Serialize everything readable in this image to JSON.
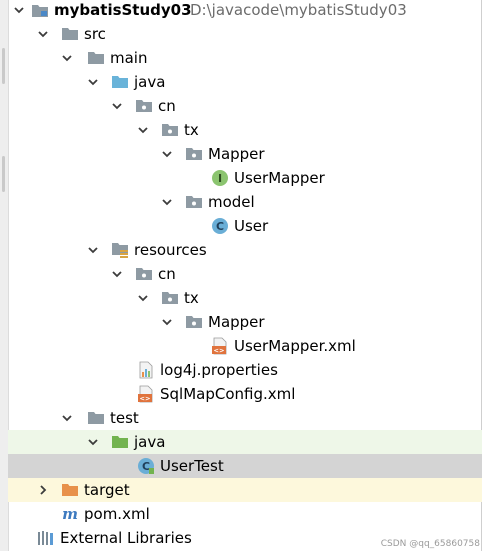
{
  "tree": {
    "project": {
      "name": "mybatisStudy03",
      "path": "D:\\javacode\\mybatisStudy03"
    },
    "items": [
      {
        "label": "src"
      },
      {
        "label": "main"
      },
      {
        "label": "java"
      },
      {
        "label": "cn"
      },
      {
        "label": "tx"
      },
      {
        "label": "Mapper"
      },
      {
        "label": "UserMapper"
      },
      {
        "label": "model"
      },
      {
        "label": "User"
      },
      {
        "label": "resources"
      },
      {
        "label": "cn"
      },
      {
        "label": "tx"
      },
      {
        "label": "Mapper"
      },
      {
        "label": "UserMapper.xml"
      },
      {
        "label": "log4j.properties"
      },
      {
        "label": "SqlMapConfig.xml"
      },
      {
        "label": "test"
      },
      {
        "label": "java"
      },
      {
        "label": "UserTest"
      },
      {
        "label": "target"
      },
      {
        "label": "pom.xml"
      },
      {
        "label": "External Libraries"
      }
    ]
  },
  "icons": {
    "folder_gray": "folder-icon",
    "folder_source": "source-root-folder-icon",
    "folder_test": "test-source-folder-icon",
    "folder_resources": "resources-folder-icon",
    "folder_excluded": "excluded-folder-icon",
    "package": "package-icon",
    "interface": "java-interface-icon",
    "class": "java-class-icon",
    "test_class": "java-test-class-icon",
    "xml": "xml-file-icon",
    "properties": "properties-file-icon",
    "maven": "maven-pom-icon",
    "libraries": "external-libraries-icon"
  },
  "colors": {
    "folder_gray": "#8e9aa3",
    "folder_source": "#69b3d9",
    "folder_test": "#72b34f",
    "folder_excluded": "#e8914a",
    "interface": "#8bc46f",
    "class": "#6aaed6",
    "selected_row": "#d4d4d4",
    "test_row": "#eef7e8",
    "excluded_row": "#fdf8dc"
  },
  "watermark": "CSDN @qq_65860758"
}
